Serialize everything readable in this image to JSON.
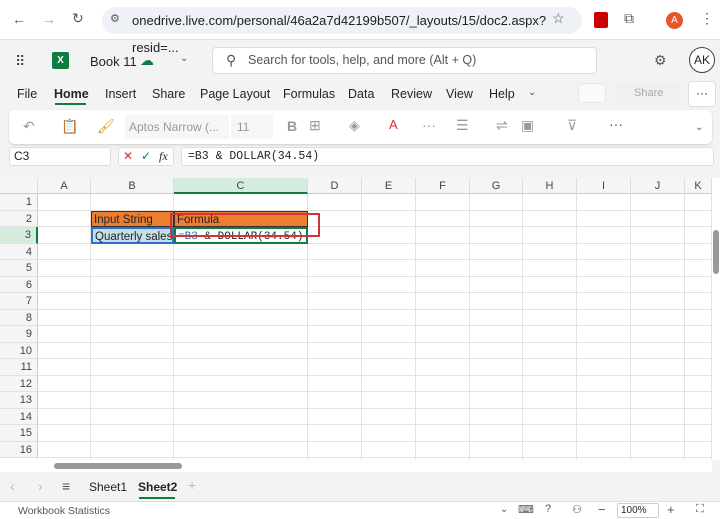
{
  "browser": {
    "url": "onedrive.live.com/personal/46a2a7d42199b507/_layouts/15/doc2.aspx?resid=...",
    "profile": "A"
  },
  "app": {
    "title": "Book 11",
    "search_placeholder": "Search for tools, help, and more (Alt + Q)",
    "user": "AK"
  },
  "menu": [
    "File",
    "Home",
    "Insert",
    "Share",
    "Page Layout",
    "Formulas",
    "Data",
    "Review",
    "View",
    "Help"
  ],
  "active_menu": "Home",
  "share_label": "Share",
  "ribbon": {
    "font": "Aptos Narrow (...",
    "size": "11"
  },
  "formula_bar": {
    "name_box": "C3",
    "formula": "=B3 & DOLLAR(34.54)"
  },
  "columns": [
    "A",
    "B",
    "C",
    "D",
    "E",
    "F",
    "G",
    "H",
    "I",
    "J",
    "K"
  ],
  "rows": [
    "1",
    "2",
    "3",
    "4",
    "5",
    "6",
    "7",
    "8",
    "9",
    "10",
    "11",
    "12",
    "13",
    "14",
    "15",
    "16"
  ],
  "cells": {
    "B2": "Input String",
    "C2": "Formula",
    "B3": "Quarterly sales",
    "C3_ref": "=B3",
    "C3_rest": " & DOLLAR(34.54)"
  },
  "colors": {
    "header_fill": "#ed7d31",
    "input_fill": "#c5e0e8",
    "accent": "#107c41",
    "highlight": "#d13438"
  },
  "sheets": [
    "Sheet1",
    "Sheet2"
  ],
  "active_sheet": "Sheet2",
  "status": {
    "left": "Workbook Statistics",
    "zoom": "100%"
  }
}
